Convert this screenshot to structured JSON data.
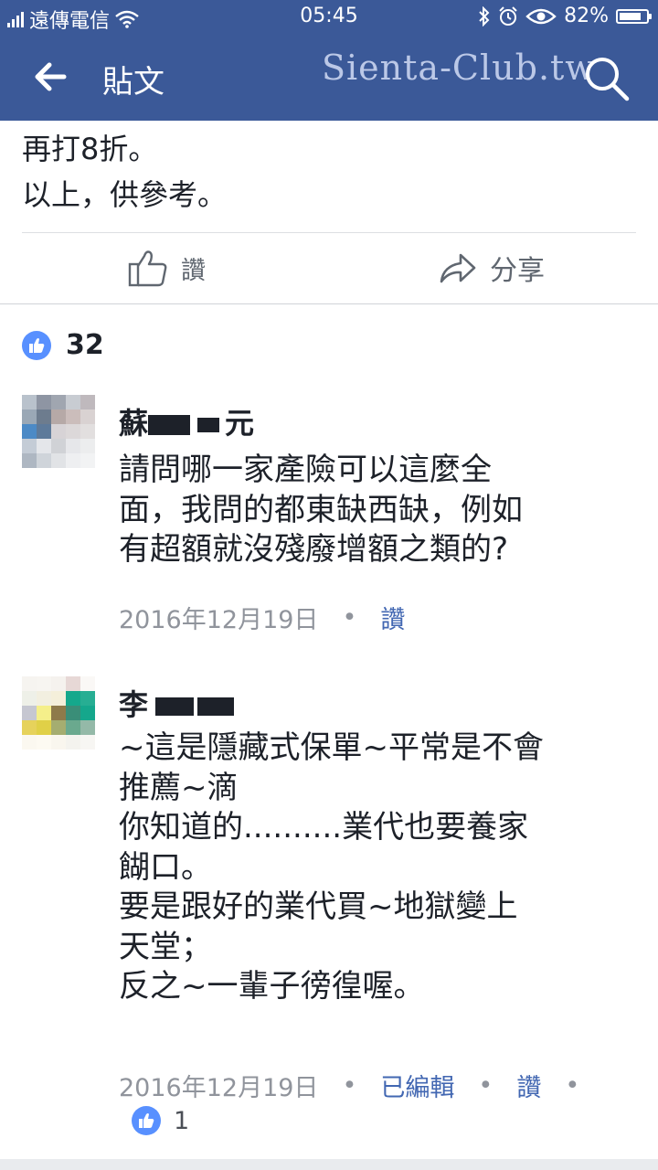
{
  "status_bar": {
    "carrier": "遠傳電信",
    "time": "05:45",
    "battery": "82%",
    "battery_level": 0.82
  },
  "header": {
    "title": "貼文",
    "watermark": "Sienta-Club.tw",
    "back_icon": "back-arrow-icon",
    "search_icon": "search-icon"
  },
  "post": {
    "lines": [
      "再打8折。",
      "以上，供參考。"
    ]
  },
  "actions": {
    "like_label": "讚",
    "share_label": "分享"
  },
  "reactions": {
    "count": "32"
  },
  "comments": [
    {
      "name_visible": "蘇",
      "name_visible_end": "元",
      "lines": [
        "請問哪一家產險可以這麼全",
        "面，我問的都東缺西缺，例如",
        "有超額就沒殘廢增額之類的?"
      ],
      "date": "2016年12月19日",
      "like_label": "讚"
    },
    {
      "name_visible": "李",
      "lines": [
        "~這是隱藏式保單~平常是不會",
        "推薦~滴",
        "你知道的..........業代也要養家",
        "餬口。",
        "要是跟好的業代買~地獄變上",
        "天堂；",
        "反之~一輩子徬徨喔。"
      ],
      "date": "2016年12月19日",
      "edited_label": "已編輯",
      "like_label": "讚",
      "like_count": "1"
    }
  ],
  "separator": "•",
  "colors": {
    "brand": "#3b5998",
    "like_blue": "#5890ff",
    "link_blue": "#4267b2"
  }
}
